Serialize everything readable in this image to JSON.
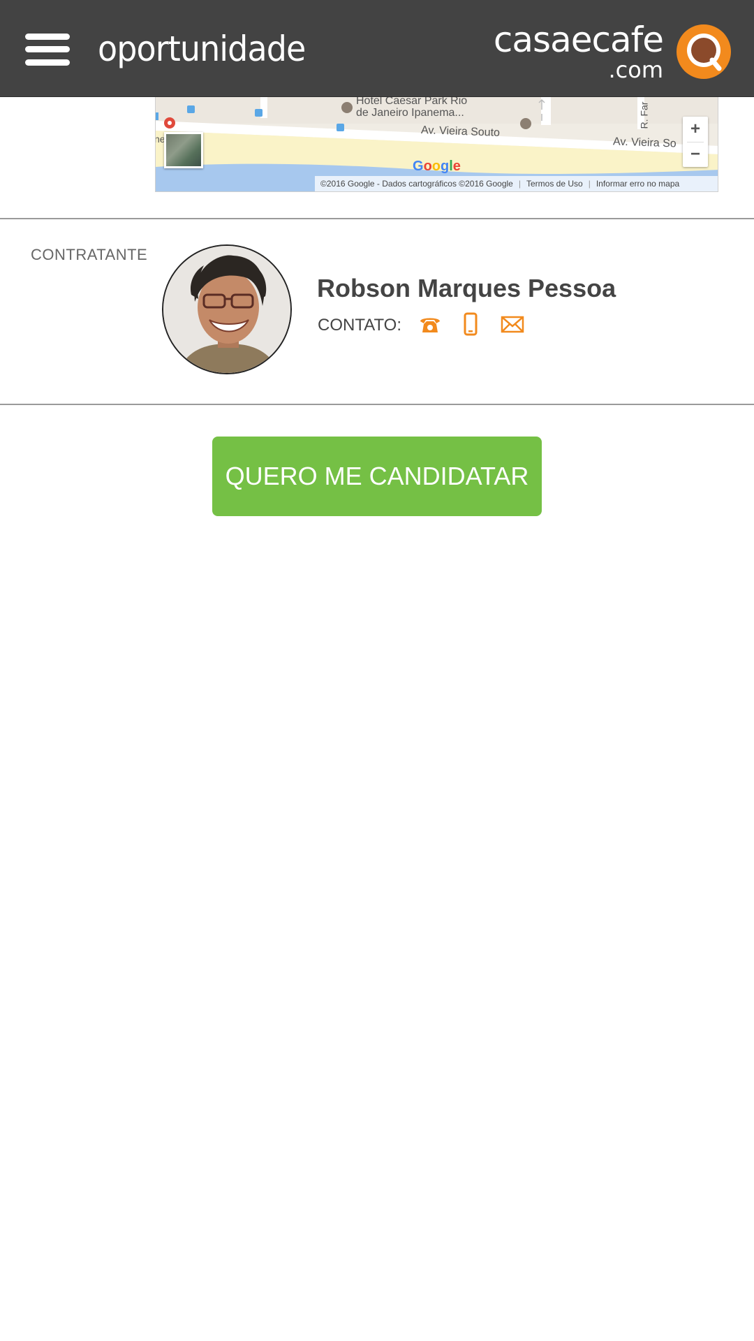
{
  "header": {
    "menu_icon": "hamburger-menu-icon",
    "title": "oportunidade",
    "logo": {
      "main": "casaecafe",
      "sub": ".com",
      "icon": "coffee-cup-logo-icon",
      "accent_color": "#f28a1d",
      "inner_color": "#8b4a2b"
    },
    "background": "#434343"
  },
  "map": {
    "labels": {
      "hotel": "Hotel Caesar Park Rio",
      "hotel_line2": "de Janeiro Ipanema...",
      "street1": "Av. Vieira Souto",
      "street2": "Av. Vieira So",
      "street3": "R. Far",
      "edge": "ne"
    },
    "zoom_in": "+",
    "zoom_out": "−",
    "google": "Google",
    "footer": {
      "copyright": "©2016 Google - Dados cartográficos ©2016 Google",
      "terms": "Termos de Uso",
      "report": "Informar erro no mapa"
    }
  },
  "contratante": {
    "label": "CONTRATANTE",
    "name": "Robson Marques Pessoa",
    "contact_label": "CONTATO:",
    "icons": [
      "phone-icon",
      "mobile-icon",
      "email-icon"
    ],
    "icon_color": "#f28a1d"
  },
  "cta": {
    "label": "QUERO ME CANDIDATAR",
    "color": "#75c045"
  }
}
